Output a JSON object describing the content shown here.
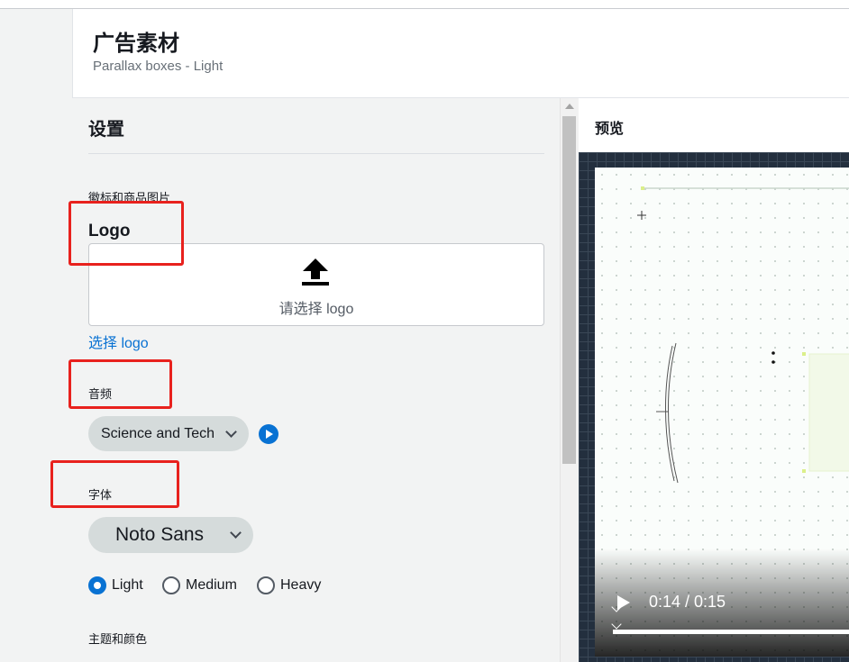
{
  "header": {
    "title": "广告素材",
    "subtitle": "Parallax boxes - Light"
  },
  "settings": {
    "title": "设置",
    "logo_section_label": "徽标和商品图片",
    "logo_label": "Logo",
    "upload_text": "请选择 logo",
    "choose_logo_link": "选择 logo",
    "audio_label": "音频",
    "audio_selected": "Science and Tech",
    "font_label": "字体",
    "font_selected": "Noto Sans",
    "weights": [
      {
        "label": "Light",
        "selected": true
      },
      {
        "label": "Medium",
        "selected": false
      },
      {
        "label": "Heavy",
        "selected": false
      }
    ],
    "theme_label": "主题和颜色"
  },
  "preview": {
    "title": "预览",
    "time": "0:14 / 0:15"
  },
  "icons": {
    "upload": "upload-arrow-icon",
    "audio_play": "play-circle-icon",
    "video_play": "play-icon"
  },
  "colors": {
    "accent": "#0972d3",
    "annotation": "#e8211d",
    "select_bg": "#d5dbdb",
    "stage_bg": "#232f3e"
  }
}
